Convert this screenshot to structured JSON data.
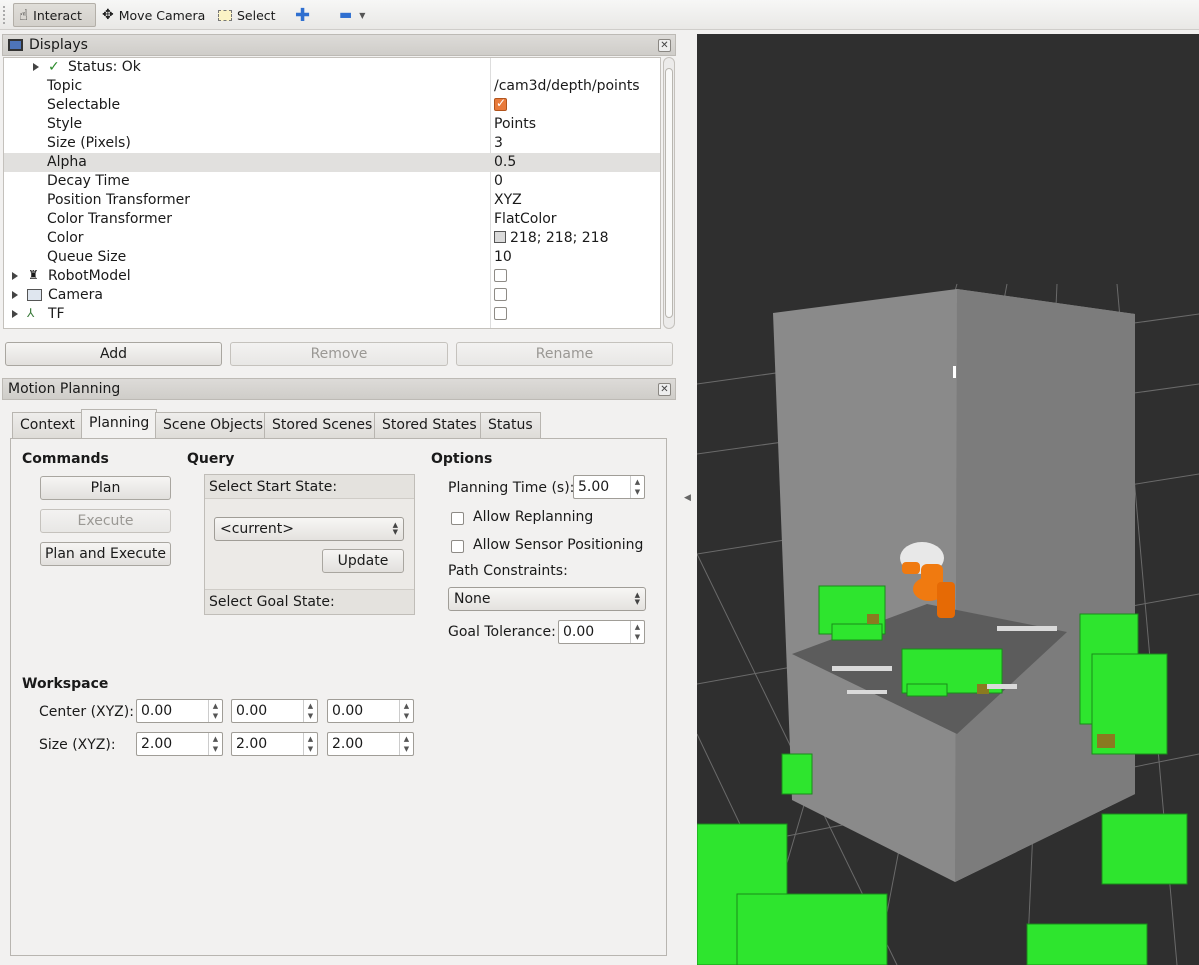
{
  "toolbar": {
    "interact": "Interact",
    "move_camera": "Move Camera",
    "select": "Select"
  },
  "displays": {
    "title": "Displays",
    "rows": [
      {
        "name": "Status: Ok",
        "value": ""
      },
      {
        "name": "Topic",
        "value": "/cam3d/depth/points"
      },
      {
        "name": "Selectable",
        "value": ""
      },
      {
        "name": "Style",
        "value": "Points"
      },
      {
        "name": "Size (Pixels)",
        "value": "3"
      },
      {
        "name": "Alpha",
        "value": "0.5"
      },
      {
        "name": "Decay Time",
        "value": "0"
      },
      {
        "name": "Position Transformer",
        "value": "XYZ"
      },
      {
        "name": "Color Transformer",
        "value": "FlatColor"
      },
      {
        "name": "Color",
        "value": "218; 218; 218"
      },
      {
        "name": "Queue Size",
        "value": "10"
      },
      {
        "name": "RobotModel",
        "value": ""
      },
      {
        "name": "Camera",
        "value": ""
      },
      {
        "name": "TF",
        "value": ""
      }
    ],
    "buttons": {
      "add": "Add",
      "remove": "Remove",
      "rename": "Rename"
    }
  },
  "motion_planning": {
    "title": "Motion Planning",
    "tabs": [
      "Context",
      "Planning",
      "Scene Objects",
      "Stored Scenes",
      "Stored States",
      "Status"
    ],
    "commands": {
      "heading": "Commands",
      "plan": "Plan",
      "execute": "Execute",
      "plan_and_execute": "Plan and Execute"
    },
    "query": {
      "heading": "Query",
      "select_start": "Select Start State:",
      "start_value": "<current>",
      "update": "Update",
      "select_goal": "Select Goal State:"
    },
    "options": {
      "heading": "Options",
      "planning_time_label": "Planning Time (s):",
      "planning_time": "5.00",
      "allow_replanning": "Allow Replanning",
      "allow_sensor": "Allow Sensor Positioning",
      "path_constraints_label": "Path Constraints:",
      "path_constraints": "None",
      "goal_tolerance_label": "Goal Tolerance:",
      "goal_tolerance": "0.00"
    },
    "workspace": {
      "heading": "Workspace",
      "center_label": "Center (XYZ):",
      "center": [
        "0.00",
        "0.00",
        "0.00"
      ],
      "size_label": "Size (XYZ):",
      "size": [
        "2.00",
        "2.00",
        "2.00"
      ]
    }
  },
  "colors": {
    "voxel_green": "#2ee52e",
    "robot_orange": "#f07a10",
    "viewport_bg": "#2f2f2f",
    "checkbox_orange": "#e87a3b"
  }
}
